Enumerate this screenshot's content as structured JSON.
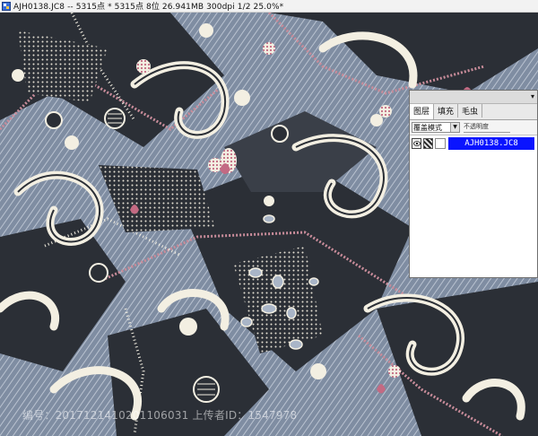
{
  "window": {
    "title": "AJH0138.JC8 -- 5315点 * 5315点 8位  26.941MB 300dpi 1/2  25.0%*"
  },
  "canvas": {
    "image_name": "paisley-print-canvas"
  },
  "layers_panel": {
    "tabs": [
      "图层",
      "填充",
      "毛虫"
    ],
    "active_tab": "图层",
    "blend_mode": "覆盖模式",
    "opacity_label": "不透明度",
    "layers": [
      {
        "name": "AJH0138.JC8",
        "selected": true
      }
    ],
    "menu_arrow": "▾"
  },
  "watermark": {
    "text": "编号：2017121410201106031 上传者ID：1547978"
  },
  "colors": {
    "accent_selected": "#0a14ff",
    "pattern_dark": "#2b2f36",
    "pattern_grey_blue": "#8a97aa",
    "pattern_cream": "#f3efe2",
    "pattern_pink": "#c88c9a"
  }
}
